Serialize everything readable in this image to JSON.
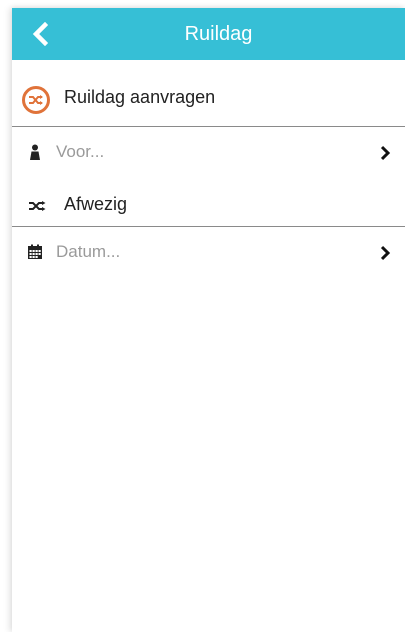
{
  "appbar": {
    "title": "Ruildag",
    "background": "#36bfd6"
  },
  "request_section": {
    "label": "Ruildag aanvragen",
    "icon": "swap-circle-icon",
    "accent": "#e0733a"
  },
  "voor_row": {
    "placeholder": "Voor...",
    "icon": "person-icon"
  },
  "absent_section": {
    "label": "Afwezig",
    "icon": "shuffle-icon"
  },
  "datum_row": {
    "placeholder": "Datum...",
    "icon": "calendar-icon"
  }
}
